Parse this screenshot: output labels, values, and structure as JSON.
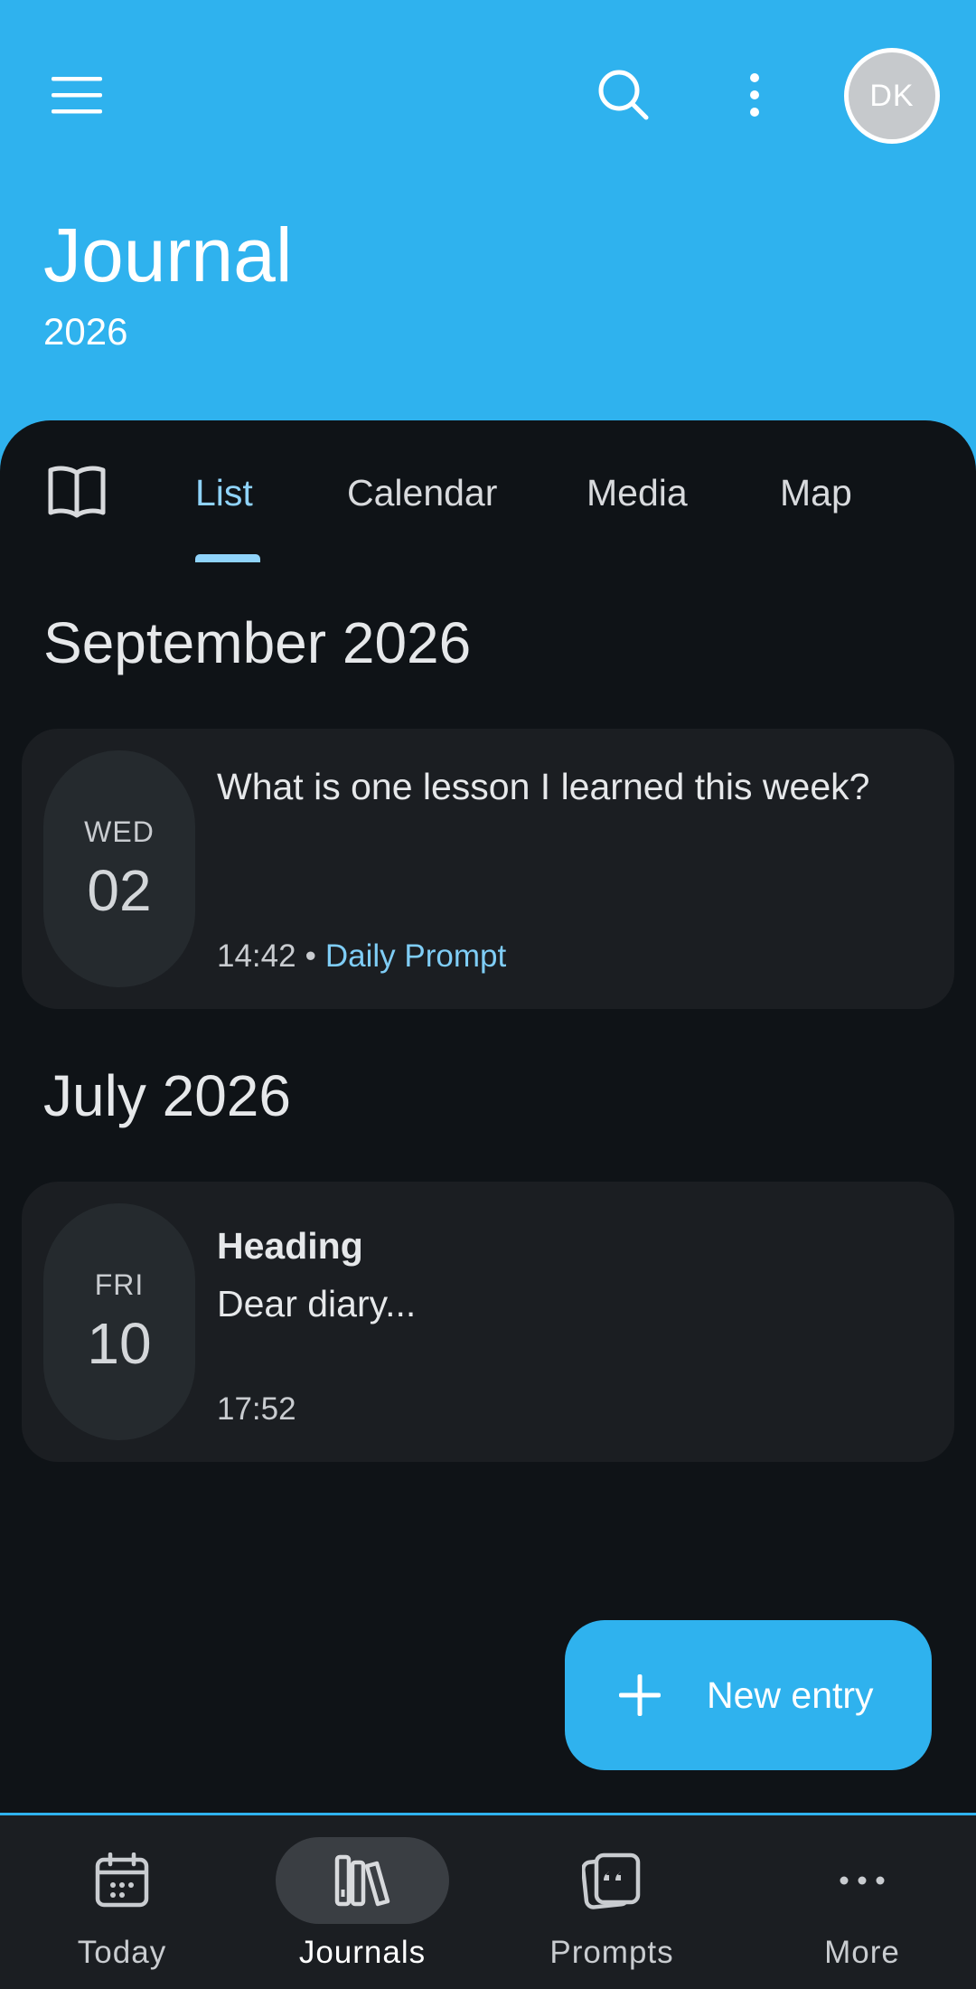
{
  "header": {
    "title": "Journal",
    "subtitle": "2026",
    "avatar_initials": "DK",
    "icons": {
      "menu": "hamburger-menu-icon",
      "search": "search-icon",
      "more": "more-vertical-icon"
    },
    "background_color": "#2fb2ee"
  },
  "tabs": {
    "items": [
      {
        "label": "List",
        "active": true
      },
      {
        "label": "Calendar",
        "active": false
      },
      {
        "label": "Media",
        "active": false
      },
      {
        "label": "Map",
        "active": false
      }
    ],
    "accent_color": "#8fd3fa"
  },
  "sections": [
    {
      "month": "September 2026",
      "entries": [
        {
          "dow": "WED",
          "day": "02",
          "text": "What is one lesson I learned this week?",
          "time": "14:42",
          "separator": "•",
          "tag": "Daily Prompt"
        }
      ]
    },
    {
      "month": "July 2026",
      "entries": [
        {
          "dow": "FRI",
          "day": "10",
          "heading": "Heading",
          "text": "Dear diary...",
          "time": "17:52"
        }
      ]
    }
  ],
  "fab": {
    "label": "New entry",
    "icon": "plus-icon"
  },
  "bottom_nav": {
    "items": [
      {
        "label": "Today",
        "icon": "calendar-icon",
        "active": false
      },
      {
        "label": "Journals",
        "icon": "journals-icon",
        "active": true
      },
      {
        "label": "Prompts",
        "icon": "prompts-quote-icon",
        "active": false
      },
      {
        "label": "More",
        "icon": "more-horizontal-icon",
        "active": false
      }
    ]
  }
}
